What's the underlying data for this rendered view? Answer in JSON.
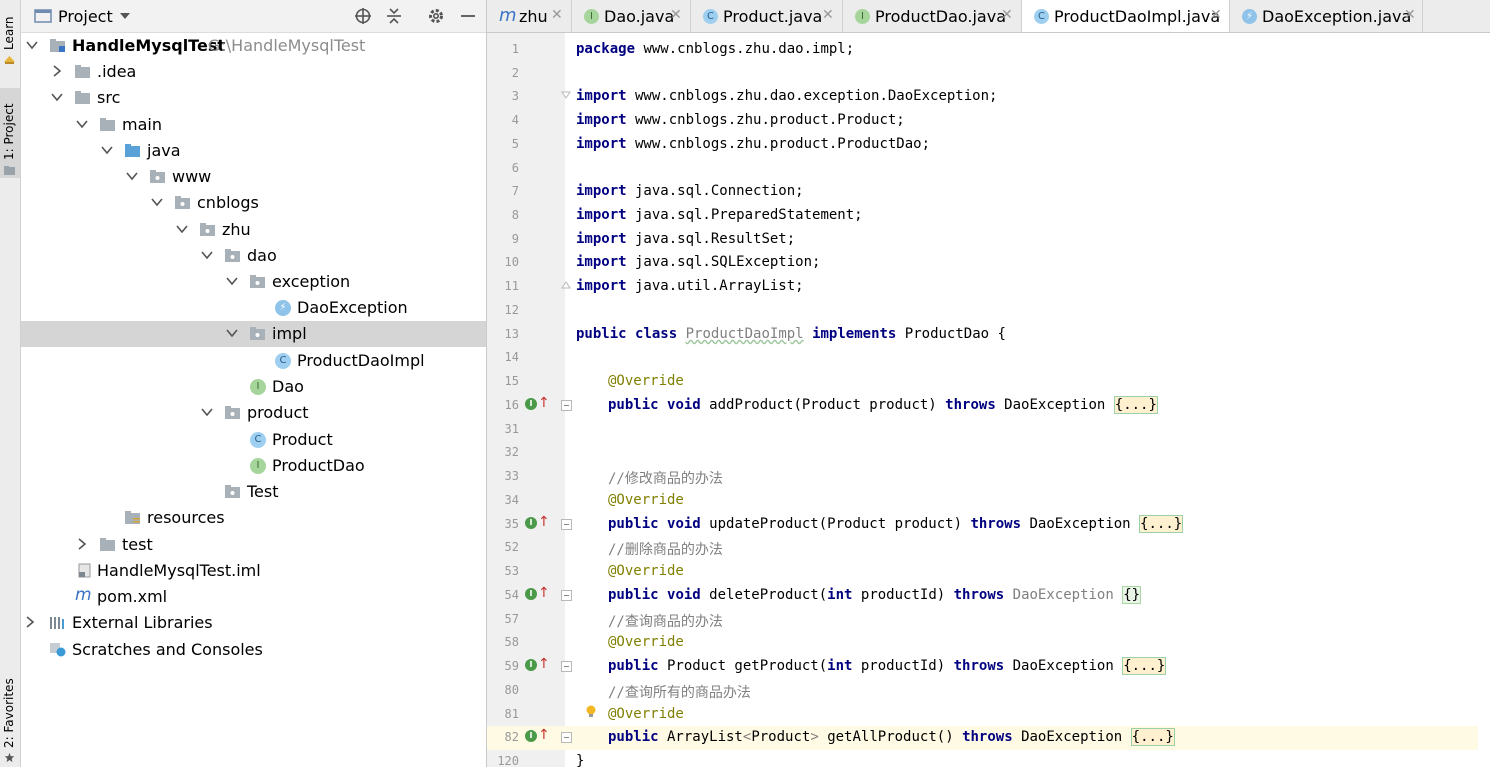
{
  "left_strip": {
    "learn_label": "Learn",
    "project_label": "1: Project",
    "favorites_label": "2: Favorites"
  },
  "project_panel": {
    "title": "Project",
    "tree": [
      {
        "label": "HandleMysqlTest",
        "path": "G:\\HandleMysqlTest",
        "icon": "module-folder-icon",
        "arrow": "down"
      },
      {
        "label": ".idea",
        "icon": "folder-icon",
        "arrow": "right"
      },
      {
        "label": "src",
        "icon": "folder-icon",
        "arrow": "down"
      },
      {
        "label": "main",
        "icon": "folder-icon",
        "arrow": "down"
      },
      {
        "label": "java",
        "icon": "source-folder-icon",
        "arrow": "down"
      },
      {
        "label": "www",
        "icon": "package-icon",
        "arrow": "down"
      },
      {
        "label": "cnblogs",
        "icon": "package-icon",
        "arrow": "down"
      },
      {
        "label": "zhu",
        "icon": "package-icon",
        "arrow": "down"
      },
      {
        "label": "dao",
        "icon": "package-icon",
        "arrow": "down"
      },
      {
        "label": "exception",
        "icon": "package-icon",
        "arrow": "down"
      },
      {
        "label": "DaoException",
        "icon": "exception-class-icon",
        "arrow": "none"
      },
      {
        "label": "impl",
        "icon": "package-icon",
        "arrow": "down",
        "selected": true
      },
      {
        "label": "ProductDaoImpl",
        "icon": "class-icon",
        "arrow": "none"
      },
      {
        "label": "Dao",
        "icon": "interface-icon",
        "arrow": "none"
      },
      {
        "label": "product",
        "icon": "package-icon",
        "arrow": "down"
      },
      {
        "label": "Product",
        "icon": "class-icon",
        "arrow": "none"
      },
      {
        "label": "ProductDao",
        "icon": "interface-icon",
        "arrow": "none"
      },
      {
        "label": "Test",
        "icon": "package-icon",
        "arrow": "none"
      },
      {
        "label": "resources",
        "icon": "resources-folder-icon",
        "arrow": "none"
      },
      {
        "label": "test",
        "icon": "folder-icon",
        "arrow": "right"
      },
      {
        "label": "HandleMysqlTest.iml",
        "icon": "iml-file-icon",
        "arrow": "none"
      },
      {
        "label": "pom.xml",
        "icon": "maven-icon",
        "arrow": "none"
      },
      {
        "label": "External Libraries",
        "icon": "libraries-icon",
        "arrow": "right"
      },
      {
        "label": "Scratches and Consoles",
        "icon": "scratches-icon",
        "arrow": "none"
      }
    ]
  },
  "tabs": [
    {
      "label": "zhu",
      "icon": "maven-icon"
    },
    {
      "label": "Dao.java",
      "icon": "interface-icon"
    },
    {
      "label": "Product.java",
      "icon": "class-icon"
    },
    {
      "label": "ProductDao.java",
      "icon": "interface-icon"
    },
    {
      "label": "ProductDaoImpl.java",
      "icon": "class-icon",
      "active": true
    },
    {
      "label": "DaoException.java",
      "icon": "exception-class-icon"
    }
  ],
  "code": {
    "line_numbers": [
      "1",
      "2",
      "3",
      "4",
      "5",
      "6",
      "7",
      "8",
      "9",
      "10",
      "11",
      "12",
      "13",
      "14",
      "15",
      "16",
      "31",
      "32",
      "33",
      "34",
      "35",
      "52",
      "53",
      "54",
      "57",
      "58",
      "59",
      "80",
      "81",
      "82",
      "120"
    ],
    "lines": {
      "l1": [
        "package",
        " www.cnblogs.zhu.dao.impl;"
      ],
      "l3": [
        "import",
        " www.cnblogs.zhu.dao.exception.DaoException;"
      ],
      "l4": [
        "import",
        " www.cnblogs.zhu.product.Product;"
      ],
      "l5": [
        "import",
        " www.cnblogs.zhu.product.ProductDao;"
      ],
      "l7": [
        "import",
        " java.sql.Connection;"
      ],
      "l8": [
        "import",
        " java.sql.PreparedStatement;"
      ],
      "l9": [
        "import",
        " java.sql.ResultSet;"
      ],
      "l10": [
        "import",
        " java.sql.SQLException;"
      ],
      "l11": [
        "import",
        " java.util.ArrayList;"
      ],
      "l13": [
        "public",
        " ",
        "class",
        " ",
        "ProductDaoImpl",
        " ",
        "implements",
        " ProductDao {"
      ],
      "l15": "@Override",
      "l16": [
        "public",
        " ",
        "void",
        " addProduct(Product product) ",
        "throws",
        " DaoException ",
        "{...}"
      ],
      "l33": "//修改商品的办法",
      "l34": "@Override",
      "l35": [
        "public",
        " ",
        "void",
        " updateProduct(Product product) ",
        "throws",
        " DaoException ",
        "{...}"
      ],
      "l52": "//删除商品的办法",
      "l53": "@Override",
      "l54": [
        "public",
        " ",
        "void",
        " deleteProduct(",
        "int",
        " productId) ",
        "throws",
        " ",
        "DaoException",
        " ",
        "{}"
      ],
      "l57": "//查询商品的办法",
      "l58": "@Override",
      "l59": [
        "public",
        " Product getProduct(",
        "int",
        " productId) ",
        "throws",
        " DaoException ",
        "{...}"
      ],
      "l80": "//查询所有的商品办法",
      "l81": "@Override",
      "l82": [
        "public",
        " ArrayList",
        "<",
        "Product",
        ">",
        " getAllProduct() ",
        "throws",
        " DaoException ",
        "{...}"
      ],
      "l120": "}"
    }
  },
  "colors": {
    "keyword": "#000080",
    "annotation": "#808000",
    "comment": "#808080",
    "selection": "#d5d5d5",
    "current_line": "#fffae3"
  }
}
